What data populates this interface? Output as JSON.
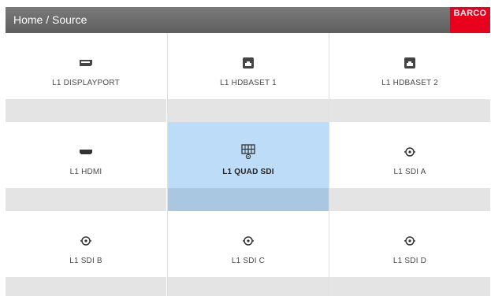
{
  "header": {
    "breadcrumb": "Home / Source",
    "logo_text": "BARCO"
  },
  "colors": {
    "header_bg": "#6b6b6b",
    "brand": "#e8001d",
    "selected": "#bcdcf7",
    "bar": "#e4e4e4"
  },
  "sources": [
    {
      "label": "L1 DISPLAYPORT",
      "icon": "displayport-icon",
      "selected": false
    },
    {
      "label": "L1 HDBASET 1",
      "icon": "hdbaset-icon",
      "selected": false
    },
    {
      "label": "L1 HDBASET 2",
      "icon": "hdbaset-icon",
      "selected": false
    },
    {
      "label": "L1 HDMI",
      "icon": "hdmi-icon",
      "selected": false
    },
    {
      "label": "L1 QUAD SDI",
      "icon": "quad-sdi-icon",
      "selected": true
    },
    {
      "label": "L1 SDI A",
      "icon": "sdi-icon",
      "selected": false
    },
    {
      "label": "L1 SDI B",
      "icon": "sdi-icon",
      "selected": false
    },
    {
      "label": "L1 SDI C",
      "icon": "sdi-icon",
      "selected": false
    },
    {
      "label": "L1 SDI D",
      "icon": "sdi-icon",
      "selected": false
    }
  ]
}
